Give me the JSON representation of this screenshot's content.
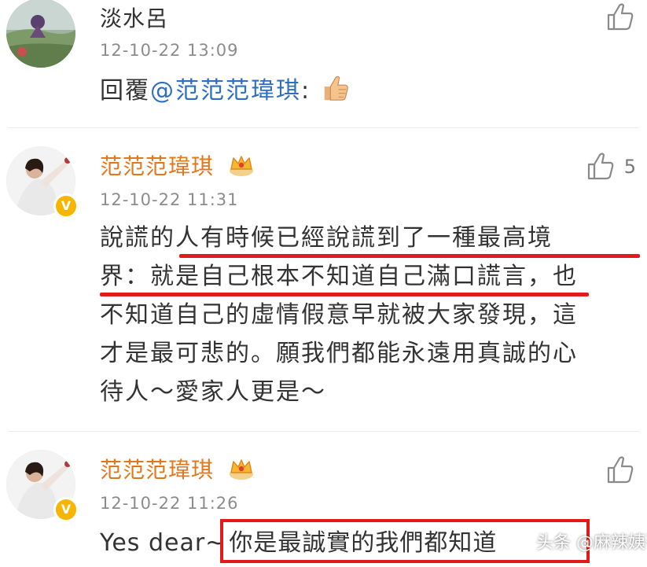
{
  "comments": [
    {
      "username": "淡水呂",
      "timestamp": "12-10-22 13:09",
      "reply_prefix": "回覆",
      "mention": "@范范范瑋琪",
      "reply_suffix": ":",
      "emoji": "thumbs-up-emoji",
      "like_icon": "thumbs-up-outline-icon"
    },
    {
      "username": "范范范瑋琪",
      "badge": "crown-icon",
      "verified": "V",
      "timestamp": "12-10-22 11:31",
      "lines": [
        "說謊的人有時候已經說謊到了一種最高境",
        "界：就是自己根本不知道自己滿口謊言，也",
        "不知道自己的虛情假意早就被大家發現，這",
        "才是最可悲的。願我們都能永遠用真誠的心",
        "待人～愛家人更是～"
      ],
      "like_icon": "thumbs-up-outline-icon",
      "like_count": "5"
    },
    {
      "username": "范范范瑋琪",
      "badge": "crown-icon",
      "verified": "V",
      "timestamp": "12-10-22 11:26",
      "text_prefix": "Yes dear~",
      "text_highlight": "你是最誠實的我們都知道",
      "like_icon": "thumbs-up-outline-icon"
    }
  ],
  "watermark": "头条 @麻辣姨哥",
  "colors": {
    "vip_name": "#e3771b",
    "mention": "#2f6fbf",
    "highlight": "#e21a1a",
    "timestamp": "#8c8c8c"
  }
}
